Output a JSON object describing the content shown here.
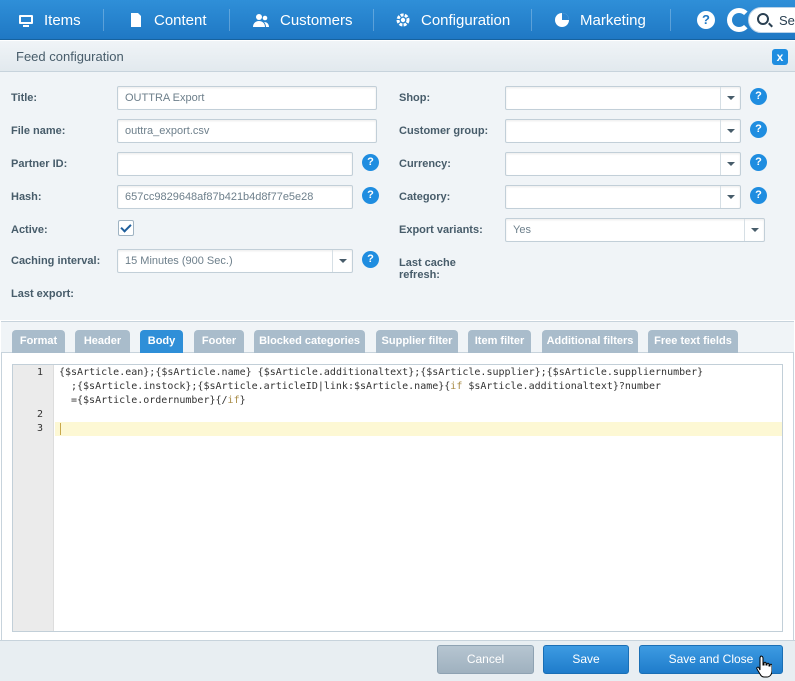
{
  "nav": {
    "items": [
      {
        "label": "Items",
        "icon": "monitor-icon"
      },
      {
        "label": "Content",
        "icon": "document-icon"
      },
      {
        "label": "Customers",
        "icon": "users-icon"
      },
      {
        "label": "Configuration",
        "icon": "gear-icon"
      },
      {
        "label": "Marketing",
        "icon": "pie-chart-icon"
      }
    ],
    "help": "?",
    "search_label": "Sea"
  },
  "window": {
    "title": "Feed configuration",
    "close": "x"
  },
  "form": {
    "title_label": "Title:",
    "title_value": "OUTTRA Export",
    "filename_label": "File name:",
    "filename_value": "outtra_export.csv",
    "partner_label": "Partner ID:",
    "partner_value": "",
    "hash_label": "Hash:",
    "hash_value": "657cc9829648af87b421b4d8f77e5e28",
    "active_label": "Active:",
    "caching_label": "Caching interval:",
    "caching_value": "15 Minutes (900 Sec.)",
    "last_export_label": "Last export:",
    "shop_label": "Shop:",
    "customer_group_label": "Customer group:",
    "currency_label": "Currency:",
    "category_label": "Category:",
    "export_variants_label": "Export variants:",
    "export_variants_value": "Yes",
    "last_cache_label": "Last cache refresh:",
    "help": "?"
  },
  "tabs": [
    "Format",
    "Header",
    "Body",
    "Footer",
    "Blocked categories",
    "Supplier filter",
    "Item filter",
    "Additional filters",
    "Free text fields"
  ],
  "editor": {
    "line_numbers": [
      "1",
      "2",
      "3"
    ],
    "line1a": "{$sArticle.ean};{$sArticle.name} {$sArticle.additionaltext};{$sArticle.supplier};{$sArticle.suppliernumber}",
    "line1b": ";{$sArticle.instock};{$sArticle.articleID|link:$sArticle.name}{",
    "line1b_if": "if",
    "line1b_rest": " $sArticle.additionaltext}?number",
    "line1c": "={$sArticle.ordernumber}{/",
    "line1c_if": "if",
    "line1c_end": "}"
  },
  "buttons": {
    "cancel": "Cancel",
    "save": "Save",
    "save_close": "Save and Close"
  }
}
